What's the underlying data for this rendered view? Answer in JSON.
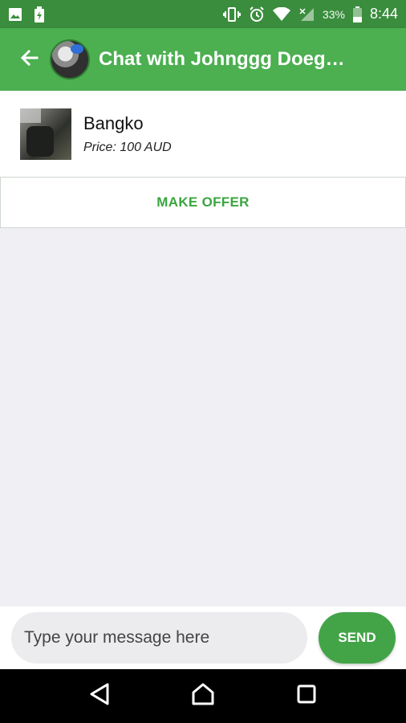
{
  "status_bar": {
    "battery_percent": "33%",
    "time": "8:44",
    "left_icons": [
      "image-icon",
      "battery-charging-icon"
    ],
    "right_icons": [
      "vibrate-icon",
      "alarm-icon",
      "wifi-icon",
      "signal-icon",
      "battery-icon"
    ]
  },
  "app_bar": {
    "title": "Chat with Johnggg Doeg…",
    "back_icon": "arrow-back-icon",
    "color": "#4caf50"
  },
  "product": {
    "name": "Bangko",
    "price": "Price: 100 AUD"
  },
  "actions": {
    "make_offer_label": "MAKE OFFER"
  },
  "composer": {
    "placeholder": "Type your message here",
    "value": "",
    "send_label": "SEND"
  },
  "nav": {
    "buttons": [
      "back-triangle-icon",
      "home-icon",
      "recents-square-icon"
    ]
  },
  "colors": {
    "status_bar": "#3a8d3d",
    "accent": "#4caf50",
    "button_text": "#3aa53f",
    "background": "#efeff4"
  }
}
